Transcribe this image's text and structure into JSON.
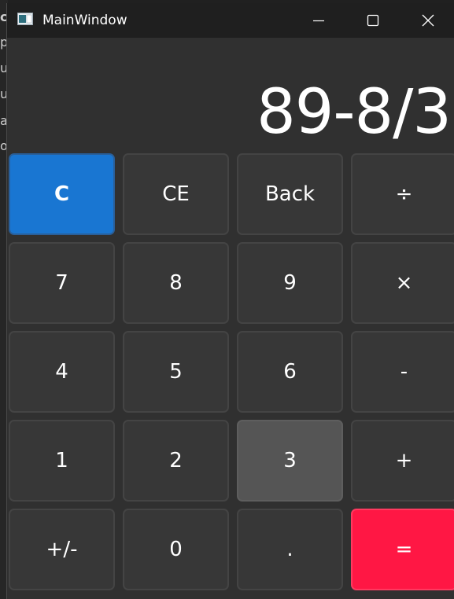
{
  "background_app": {
    "fragments": [
      "cu",
      "p",
      "ul",
      "ul",
      "a",
      "o"
    ]
  },
  "window": {
    "title": "MainWindow",
    "icon": "window-app-icon",
    "controls": {
      "minimize_icon": "minimize-icon",
      "maximize_icon": "maximize-icon",
      "close_icon": "close-icon"
    }
  },
  "display": {
    "expression": "89-8/3"
  },
  "keypad": {
    "rows": [
      [
        {
          "label": "C",
          "role": "clear"
        },
        {
          "label": "CE",
          "role": "clear-entry"
        },
        {
          "label": "Back",
          "role": "backspace"
        },
        {
          "label": "÷",
          "role": "divide"
        }
      ],
      [
        {
          "label": "7",
          "role": "digit"
        },
        {
          "label": "8",
          "role": "digit"
        },
        {
          "label": "9",
          "role": "digit"
        },
        {
          "label": "×",
          "role": "multiply"
        }
      ],
      [
        {
          "label": "4",
          "role": "digit"
        },
        {
          "label": "5",
          "role": "digit"
        },
        {
          "label": "6",
          "role": "digit"
        },
        {
          "label": "-",
          "role": "subtract"
        }
      ],
      [
        {
          "label": "1",
          "role": "digit"
        },
        {
          "label": "2",
          "role": "digit"
        },
        {
          "label": "3",
          "role": "digit",
          "state": "pressed"
        },
        {
          "label": "+",
          "role": "add"
        }
      ],
      [
        {
          "label": "+/-",
          "role": "negate"
        },
        {
          "label": "0",
          "role": "digit"
        },
        {
          "label": ".",
          "role": "decimal"
        },
        {
          "label": "=",
          "role": "equals"
        }
      ]
    ]
  },
  "colors": {
    "clear_key": "#1976d2",
    "equals_key": "#ff1744",
    "pressed_key": "#555555",
    "key": "#373737",
    "window_bg": "#303030",
    "titlebar_bg": "#1f1f1f"
  }
}
